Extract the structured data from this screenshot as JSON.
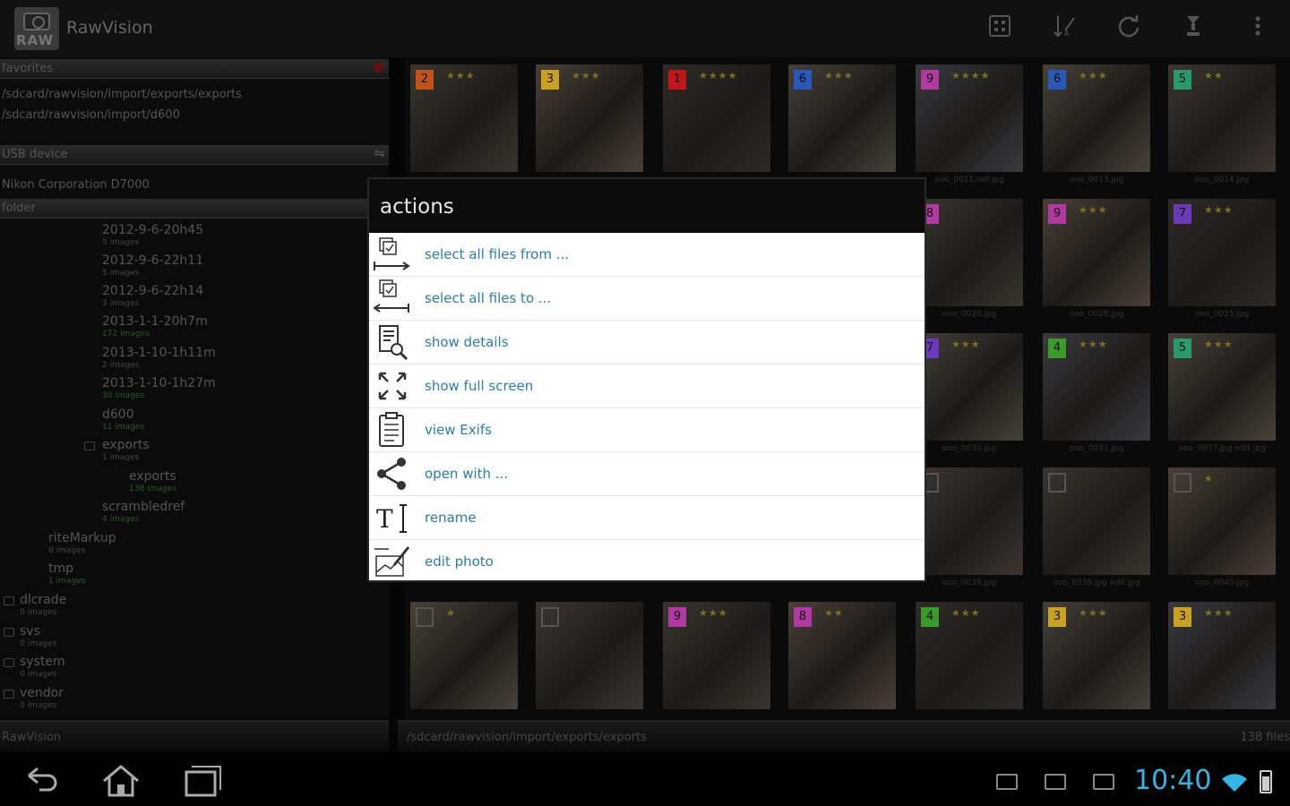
{
  "app": {
    "title": "RawVision",
    "icon_text": "RAW"
  },
  "actionbar": {
    "icons": [
      "grid-view-icon",
      "sort-icon",
      "refresh-icon",
      "import-icon",
      "overflow-menu-icon"
    ]
  },
  "left": {
    "favorites_label": "favorites",
    "favorite_paths": [
      "/sdcard/rawvision/import/exports/exports",
      "/sdcard/rawvision/import/d600"
    ],
    "usb_label": "USB device",
    "usb_device": "Nikon Corporation D7000",
    "folder_label": "folder",
    "tree": [
      {
        "name": "2012-9-6-20h45",
        "sub": "5 images",
        "green": false
      },
      {
        "name": "2012-9-6-22h11",
        "sub": "5 images",
        "green": false
      },
      {
        "name": "2012-9-6-22h14",
        "sub": "3 images",
        "green": false
      },
      {
        "name": "2013-1-1-20h7m",
        "sub": "172 images",
        "green": true
      },
      {
        "name": "2013-1-10-1h11m",
        "sub": "2 images",
        "green": false
      },
      {
        "name": "2013-1-10-1h27m",
        "sub": "30 images",
        "green": true
      },
      {
        "name": "d600",
        "sub": "11 images",
        "green": true
      },
      {
        "name": "exports",
        "sub": "1 images",
        "green": false
      },
      {
        "name": "exports",
        "sub": "138 images",
        "green": true
      },
      {
        "name": "scrambledref",
        "sub": "4 images",
        "green": true
      },
      {
        "name": "riteMarkup",
        "sub": "0 images",
        "green": false
      },
      {
        "name": "tmp",
        "sub": "1 images",
        "green": true
      },
      {
        "name": "dlcrade",
        "sub": "0 images",
        "green": false
      },
      {
        "name": "svs",
        "sub": "0 images",
        "green": false
      },
      {
        "name": "system",
        "sub": "0 images",
        "green": false
      },
      {
        "name": "vendor",
        "sub": "0 images",
        "green": false
      }
    ],
    "footer": "RawVision"
  },
  "grid": {
    "rows": [
      [
        {
          "badge": "2",
          "color": "#c0521a",
          "stars": "★★★",
          "label": ""
        },
        {
          "badge": "3",
          "color": "#c9a020",
          "stars": "★★★",
          "label": ""
        },
        {
          "badge": "1",
          "color": "#c0181a",
          "stars": "★★★★",
          "label": ""
        },
        {
          "badge": "6",
          "color": "#2a58b8",
          "stars": "★★★",
          "label": ""
        },
        {
          "badge": "9",
          "color": "#b03aa0",
          "stars": "★★★★",
          "label": "ooo_0011.nef.jpg"
        },
        {
          "badge": "6",
          "color": "#2a58b8",
          "stars": "★★★",
          "label": "ooo_0013.jpg"
        },
        {
          "badge": "5",
          "color": "#2a9a6a",
          "stars": "★★",
          "label": "ooo_0014.jpg"
        }
      ],
      [
        {
          "badge": "8",
          "color": "#b03aa0",
          "stars": "",
          "label": "ooo_0020.jpg"
        },
        {
          "badge": "9",
          "color": "#b03aa0",
          "stars": "★★★",
          "label": "ooo_0028.jpg"
        },
        {
          "badge": "7",
          "color": "#6a3ab8",
          "stars": "★★★",
          "label": "ooo_0025.jpg"
        }
      ],
      [
        {
          "badge": "7",
          "color": "#6a3ab8",
          "stars": "★★★",
          "label": "ooo_0030.jpg"
        },
        {
          "badge": "4",
          "color": "#3a9a2a",
          "stars": "★★★",
          "label": "ooo_0031.jpg"
        },
        {
          "badge": "5",
          "color": "#2a9a6a",
          "stars": "★★★",
          "label": "ooo_0037.jpg edit.jpg"
        }
      ],
      [
        {
          "badge": "",
          "color": "",
          "stars": "",
          "label": "ooo_0039.jpg"
        },
        {
          "badge": "",
          "color": "",
          "stars": "",
          "label": "ooo_0039.jpg edit.jpg"
        },
        {
          "badge": "",
          "color": "",
          "stars": "★",
          "label": "ooo_0040.jpg"
        }
      ],
      [
        {
          "badge": "",
          "color": "",
          "stars": "★",
          "label": ""
        },
        {
          "badge": "",
          "color": "",
          "stars": "",
          "label": ""
        },
        {
          "badge": "9",
          "color": "#b03aa0",
          "stars": "★★★",
          "label": ""
        },
        {
          "badge": "8",
          "color": "#b03aa0",
          "stars": "★★",
          "label": ""
        },
        {
          "badge": "4",
          "color": "#3a9a2a",
          "stars": "★★★",
          "label": ""
        },
        {
          "badge": "3",
          "color": "#c9a020",
          "stars": "★★★",
          "label": ""
        },
        {
          "badge": "3",
          "color": "#c9a020",
          "stars": "★★★",
          "label": ""
        }
      ]
    ]
  },
  "status": {
    "path": "/sdcard/rawvision/import/exports/exports",
    "count": "138 files"
  },
  "dialog": {
    "title": "actions",
    "items": [
      {
        "label": "select all files from ...",
        "icon": "select-from-icon"
      },
      {
        "label": "select all files to ...",
        "icon": "select-to-icon"
      },
      {
        "label": "show details",
        "icon": "details-icon"
      },
      {
        "label": "show full screen",
        "icon": "fullscreen-icon"
      },
      {
        "label": "view Exifs",
        "icon": "clipboard-icon"
      },
      {
        "label": "open with ...",
        "icon": "share-icon"
      },
      {
        "label": "rename",
        "icon": "rename-icon"
      },
      {
        "label": "edit photo",
        "icon": "edit-photo-icon"
      }
    ]
  },
  "navbar": {
    "clock": "10:40"
  }
}
